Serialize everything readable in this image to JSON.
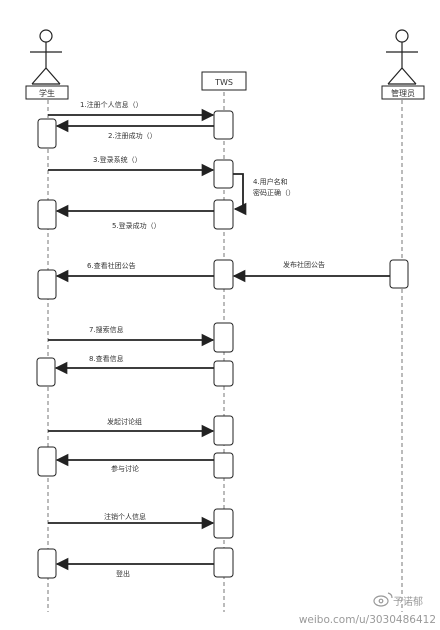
{
  "actors": {
    "student": "学生",
    "system": "TWS",
    "admin": "管理员"
  },
  "messages": [
    {
      "id": "m1",
      "text": "1.注册个人信息（）"
    },
    {
      "id": "m2",
      "text": "2.注册成功（）"
    },
    {
      "id": "m3",
      "text": "3.登录系统（）"
    },
    {
      "id": "m4",
      "text_line1": "4.用户名和",
      "text_line2": "密码正确（）"
    },
    {
      "id": "m5",
      "text": "5.登录成功（）"
    },
    {
      "id": "m6a",
      "text": "发布社团公告"
    },
    {
      "id": "m6",
      "text": "6.查看社团公告"
    },
    {
      "id": "m7",
      "text": "7.搜索信息"
    },
    {
      "id": "m8",
      "text": "8.查看信息"
    },
    {
      "id": "m9",
      "text": "发起讨论组"
    },
    {
      "id": "m10",
      "text": "参与讨论"
    },
    {
      "id": "m11",
      "text": "注销个人信息"
    },
    {
      "id": "m12",
      "text": "登出"
    }
  ],
  "watermark": {
    "name": "予诺郁",
    "url": "weibo.com/u/3030486412"
  }
}
